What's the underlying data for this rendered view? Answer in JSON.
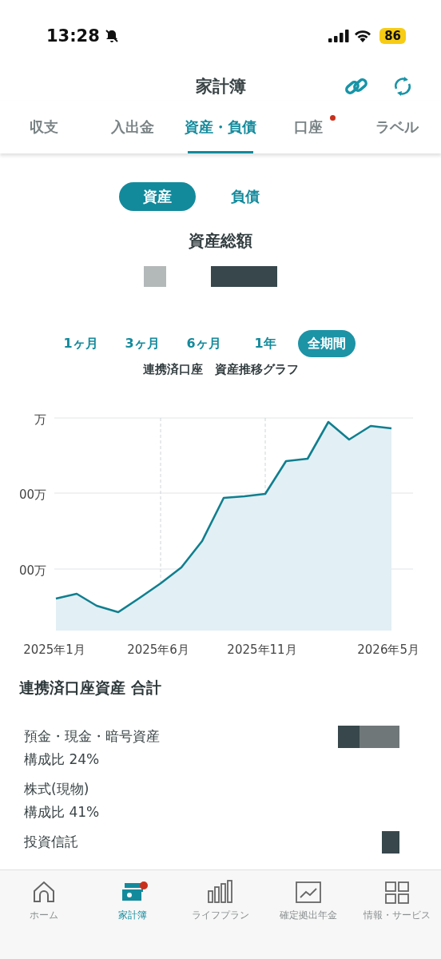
{
  "status_bar": {
    "time": "13:28",
    "battery": "86"
  },
  "header": {
    "title": "家計簿"
  },
  "tabs": [
    {
      "label": "収支",
      "selected": false,
      "badge": false
    },
    {
      "label": "入出金",
      "selected": false,
      "badge": false
    },
    {
      "label": "資産・負債",
      "selected": true,
      "badge": false
    },
    {
      "label": "口座",
      "selected": false,
      "badge": true
    },
    {
      "label": "ラベル",
      "selected": false,
      "badge": false
    }
  ],
  "segments": [
    {
      "label": "資産",
      "selected": true
    },
    {
      "label": "負債",
      "selected": false
    }
  ],
  "total": {
    "label": "資産総額"
  },
  "periods": [
    {
      "label": "1ヶ月",
      "selected": false
    },
    {
      "label": "3ヶ月",
      "selected": false
    },
    {
      "label": "6ヶ月",
      "selected": false
    },
    {
      "label": "1年",
      "selected": false
    },
    {
      "label": "全期間",
      "selected": true
    }
  ],
  "chart": {
    "title": "連携済口座　資産推移グラフ",
    "y_labels": [
      "万",
      "00万",
      "00万"
    ],
    "x_labels": [
      "2025年1月",
      "2025年6月",
      "2025年11月",
      "2026年5月"
    ]
  },
  "section": {
    "title": "連携済口座資産 合計",
    "rows": [
      {
        "name": "預金・現金・暗号資産",
        "ratio": "構成比 24%"
      },
      {
        "name": "株式(現物)",
        "ratio": "構成比 41%"
      },
      {
        "name": "投資信託"
      }
    ]
  },
  "bottom_nav": [
    {
      "label": "ホーム",
      "selected": false,
      "badge": false
    },
    {
      "label": "家計簿",
      "selected": true,
      "badge": true
    },
    {
      "label": "ライフプラン",
      "selected": false,
      "badge": false
    },
    {
      "label": "確定拠出年金",
      "selected": false,
      "badge": false
    },
    {
      "label": "情報・サービス",
      "selected": false,
      "badge": false
    }
  ]
}
